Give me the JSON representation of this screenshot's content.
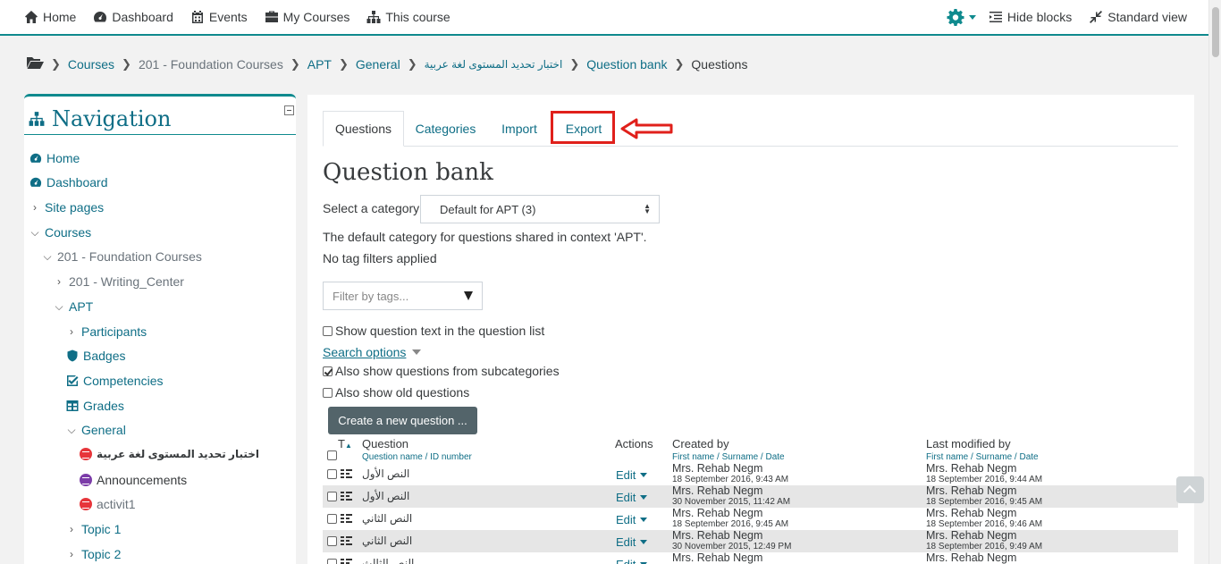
{
  "navbar": {
    "items": [
      {
        "label": "Home",
        "icon": "home-icon"
      },
      {
        "label": "Dashboard",
        "icon": "dashboard-icon"
      },
      {
        "label": "Events",
        "icon": "calendar-icon"
      },
      {
        "label": "My Courses",
        "icon": "briefcase-icon"
      },
      {
        "label": "This course",
        "icon": "sitemap-icon"
      }
    ],
    "hide_blocks": "Hide blocks",
    "standard_view": "Standard view"
  },
  "breadcrumb": {
    "items": [
      "Courses",
      "201 - Foundation Courses",
      "APT",
      "General",
      "اختبار تحديد المستوى لغة عربية",
      "Question bank",
      "Questions"
    ]
  },
  "navigation": {
    "title": "Navigation",
    "items": [
      "Home",
      "Dashboard",
      "Site pages",
      "Courses",
      "201 - Foundation Courses",
      "201 - Writing_Center",
      "APT",
      "Participants",
      "Badges",
      "Competencies",
      "Grades",
      "General",
      "اختبار تحديد المستوى لغة عربية",
      "Announcements",
      "activit1",
      "Topic 1",
      "Topic 2"
    ]
  },
  "tabs": [
    "Questions",
    "Categories",
    "Import",
    "Export"
  ],
  "main": {
    "heading": "Question bank",
    "select_label": "Select a category:",
    "select_value": "Default for APT (3)",
    "category_info": "The default category for questions shared in context 'APT'.",
    "tag_info": "No tag filters applied",
    "tag_placeholder": "Filter by tags...",
    "show_text": "Show question text in the question list",
    "search_options": "Search options",
    "subcategories": "Also show questions from subcategories",
    "old_questions": "Also show old questions",
    "create_button": "Create a new question ..."
  },
  "table": {
    "col_t": "T",
    "col_question": "Question",
    "col_question_sub": "Question name / ID number",
    "col_actions": "Actions",
    "col_created": "Created by",
    "col_created_sub": "First name / Surname / Date",
    "col_modified": "Last modified by",
    "col_modified_sub": "First name / Surname / Date",
    "edit_label": "Edit",
    "rows": [
      {
        "name": "النص الأول",
        "created_by": "Mrs. Rehab Negm",
        "created_date": "18 September 2016, 9:43 AM",
        "modified_by": "Mrs. Rehab Negm",
        "modified_date": "18 September 2016, 9:44 AM"
      },
      {
        "name": "النص الأول",
        "created_by": "Mrs. Rehab Negm",
        "created_date": "30 November 2015, 11:42 AM",
        "modified_by": "Mrs. Rehab Negm",
        "modified_date": "18 September 2016, 9:45 AM"
      },
      {
        "name": "النص الثاني",
        "created_by": "Mrs. Rehab Negm",
        "created_date": "18 September 2016, 9:45 AM",
        "modified_by": "Mrs. Rehab Negm",
        "modified_date": "18 September 2016, 9:46 AM"
      },
      {
        "name": "النص الثاني",
        "created_by": "Mrs. Rehab Negm",
        "created_date": "30 November 2015, 12:49 PM",
        "modified_by": "Mrs. Rehab Negm",
        "modified_date": "18 September 2016, 9:49 AM"
      },
      {
        "name": "النص الثالث",
        "created_by": "Mrs. Rehab Negm",
        "created_date": "",
        "modified_by": "Mrs. Rehab Negm",
        "modified_date": ""
      }
    ]
  },
  "colors": {
    "accent": "#0f8a8e",
    "link": "#0f6e86",
    "highlight": "#e0201b"
  }
}
